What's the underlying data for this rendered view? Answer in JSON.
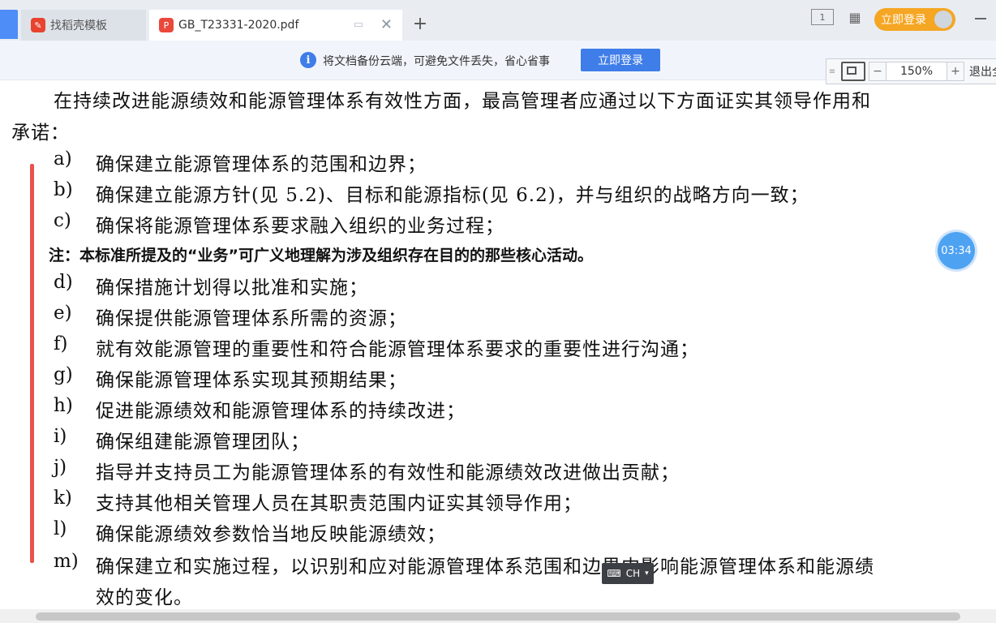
{
  "tabs": [
    {
      "label": "找稻壳模板",
      "icon": "daoke-logo-icon"
    },
    {
      "label": "GB_T23331-2020.pdf",
      "icon": "pdf-icon"
    }
  ],
  "header": {
    "login_label": "立即登录"
  },
  "notice": {
    "text": "将文档备份云端，可避免文件丢失，省心省事",
    "button_label": "立即登录"
  },
  "zoom": {
    "value": "150%",
    "exit_label": "退出全"
  },
  "timer": "03:34",
  "ime": "CH",
  "document": {
    "intro_line1": "在持续改进能源绩效和能源管理体系有效性方面，最高管理者应通过以下方面证实其领导作用和",
    "intro_line2": "承诺：",
    "items": [
      {
        "label": "a)",
        "text": "确保建立能源管理体系的范围和边界；"
      },
      {
        "label": "b)",
        "text": "确保建立能源方针(见 5.2)、目标和能源指标(见 6.2)，并与组织的战略方向一致；"
      },
      {
        "label": "c)",
        "text": "确保将能源管理体系要求融入组织的业务过程；"
      },
      {
        "label": "d)",
        "text": "确保措施计划得以批准和实施；"
      },
      {
        "label": "e)",
        "text": "确保提供能源管理体系所需的资源；"
      },
      {
        "label": "f)",
        "text": "就有效能源管理的重要性和符合能源管理体系要求的重要性进行沟通；"
      },
      {
        "label": "g)",
        "text": "确保能源管理体系实现其预期结果；"
      },
      {
        "label": "h)",
        "text": "促进能源绩效和能源管理体系的持续改进；"
      },
      {
        "label": "i)",
        "text": "确保组建能源管理团队；"
      },
      {
        "label": "j)",
        "text": "指导并支持员工为能源管理体系的有效性和能源绩效改进做出贡献；"
      },
      {
        "label": "k)",
        "text": "支持其他相关管理人员在其职责范围内证实其领导作用；"
      },
      {
        "label": "l)",
        "text": "确保能源绩效参数恰当地反映能源绩效；"
      },
      {
        "label": "m)",
        "text": "确保建立和实施过程，以识别和应对能源管理体系范围和边界内影响能源管理体系和能源绩"
      },
      {
        "label": "",
        "text": "效的变化。"
      }
    ],
    "note": "注：本标准所提及的“业务”可广义地理解为涉及组织存在目的的那些核心活动。"
  },
  "colors": {
    "accent": "#3f7de8",
    "login": "#f5a623",
    "annotation_bar": "#e8544a"
  }
}
